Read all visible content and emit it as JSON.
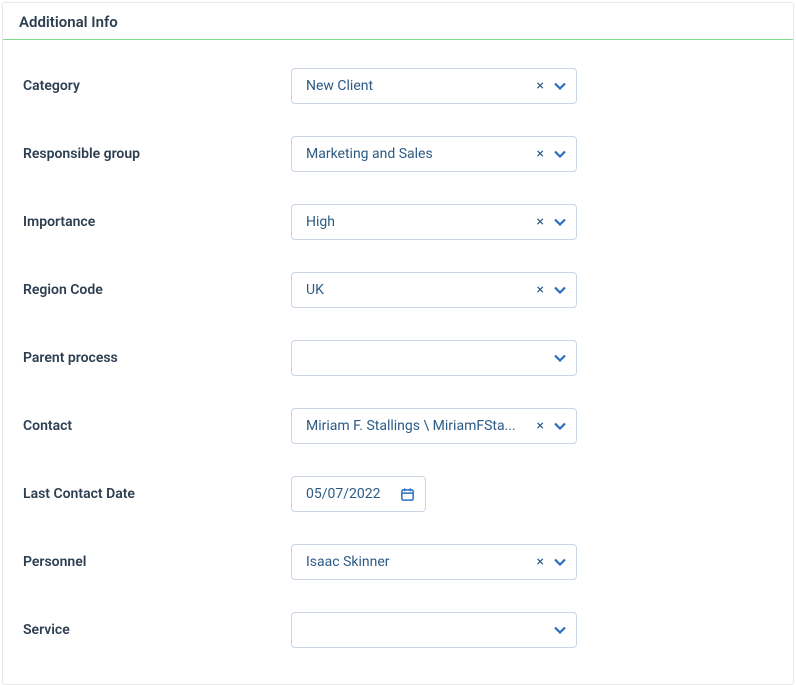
{
  "panel": {
    "title": "Additional Info"
  },
  "fields": {
    "category": {
      "label": "Category",
      "value": "New Client",
      "has_clear": true
    },
    "responsible_group": {
      "label": "Responsible group",
      "value": "Marketing and Sales",
      "has_clear": true
    },
    "importance": {
      "label": "Importance",
      "value": "High",
      "has_clear": true
    },
    "region_code": {
      "label": "Region Code",
      "value": "UK",
      "has_clear": true
    },
    "parent_process": {
      "label": "Parent process",
      "value": "",
      "has_clear": false
    },
    "contact": {
      "label": "Contact",
      "value": "Miriam F. Stallings \\ MiriamFSta...",
      "has_clear": true
    },
    "last_contact_date": {
      "label": "Last Contact Date",
      "value": "05/07/2022"
    },
    "personnel": {
      "label": "Personnel",
      "value": "Isaac Skinner",
      "has_clear": true
    },
    "service": {
      "label": "Service",
      "value": "",
      "has_clear": false
    }
  }
}
